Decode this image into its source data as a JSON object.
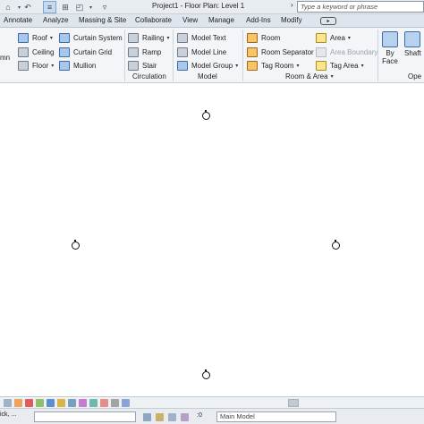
{
  "app": {
    "title": "Project1 - Floor Plan: Level 1",
    "search_placeholder": "Type a keyword or phrase",
    "title_arrow": "›"
  },
  "tabs": [
    "Annotate",
    "Analyze",
    "Massing & Site",
    "Collaborate",
    "View",
    "Manage",
    "Add-Ins",
    "Modify"
  ],
  "ribbon": {
    "partial_left_label": "mn",
    "build": {
      "roof": "Roof",
      "ceiling": "Ceiling",
      "floor": "Floor",
      "curtain_system": "Curtain System",
      "curtain_grid": "Curtain Grid",
      "mullion": "Mullion"
    },
    "circulation": {
      "label": "Circulation",
      "railing": "Railing",
      "ramp": "Ramp",
      "stair": "Stair"
    },
    "model": {
      "label": "Model",
      "model_text": "Model Text",
      "model_line": "Model Line",
      "model_group": "Model Group"
    },
    "room_area": {
      "label": "Room & Area",
      "room": "Room",
      "room_separator": "Room Separator",
      "tag_room": "Tag Room",
      "area": "Area",
      "area_boundary": "Area Boundary",
      "tag_area": "Tag Area"
    },
    "opening": {
      "label_partial": "Ope",
      "by_face_line1": "By",
      "by_face_line2": "Face",
      "shaft": "Shaft"
    }
  },
  "statusbar": {
    "left_text": "ick, ...",
    "zero": ":0",
    "workset": "Main Model"
  },
  "colors": {
    "ribbon_bg": "#f3f5f8",
    "tab_bg": "#dfe5ec",
    "canvas_bg": "#ffffff"
  }
}
